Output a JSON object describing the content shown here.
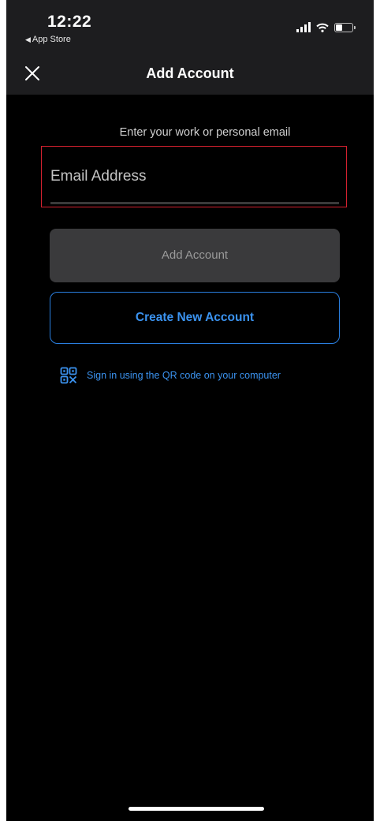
{
  "status_bar": {
    "time": "12:22",
    "back_app": "App Store",
    "back_symbol": "◀"
  },
  "nav": {
    "title": "Add Account",
    "close_icon": "close-icon"
  },
  "form": {
    "instruction": "Enter your work or personal email",
    "email_placeholder": "Email Address",
    "email_value": "",
    "add_button": "Add Account",
    "create_button": "Create New Account",
    "qr_link": "Sign in using the QR code on your computer",
    "qr_icon": "qr-code-icon"
  },
  "colors": {
    "accent": "#3b93f0",
    "focus_border": "#d3212f",
    "disabled_button": "#3a3a3c",
    "background": "#000000",
    "bar_background": "#1d1d1f"
  }
}
